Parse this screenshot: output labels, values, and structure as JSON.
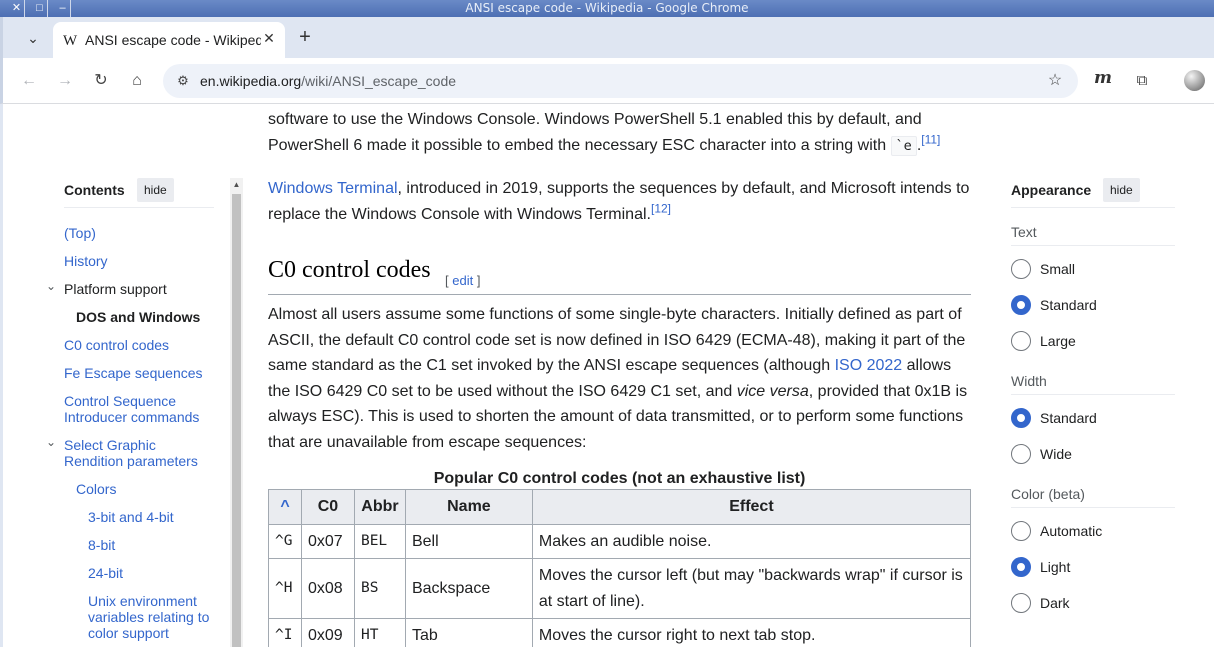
{
  "window": {
    "title": "ANSI escape code - Wikipedia - Google Chrome"
  },
  "tabs": {
    "active": {
      "favicon": "W",
      "title": "ANSI escape code - Wikipedia"
    }
  },
  "toolbar": {
    "url_domain": "en.wikipedia.org",
    "url_path": "/wiki/ANSI_escape_code"
  },
  "article": {
    "intro_line1": "software to use the Windows Console. Windows PowerShell 5.1 enabled this by default, and",
    "intro_line2": "PowerShell 6 made it possible to embed the necessary ESC character into a string with",
    "intro_code": "`e",
    "intro_end": ".",
    "intro_ref": "[11]",
    "terminal_link": "Windows Terminal",
    "terminal_text": ", introduced in 2019, supports the sequences by default, and Microsoft intends to replace the Windows Console with Windows Terminal.",
    "terminal_ref": "[12]",
    "section_heading": "C0 control codes",
    "edit_open": "[ ",
    "edit_label": "edit",
    "edit_close": " ]",
    "c0_text_1": "Almost all users assume some functions of some single-byte characters. Initially defined as part of ASCII, the default C0 control code set is now defined in ISO 6429 (ECMA-48), making it part of the same standard as the C1 set invoked by the ANSI escape sequences (although ",
    "c0_link": "ISO 2022",
    "c0_text_2": " allows the ISO 6429 C0 set to be used without the ISO 6429 C1 set, and ",
    "c0_italic": "vice versa",
    "c0_text_3": ", provided that 0x1B is always ESC). This is used to shorten the amount of data transmitted, or to perform some functions that are unavailable from escape sequences:",
    "table_caption": "Popular C0 control codes (not an exhaustive list)",
    "table_headers": [
      "^",
      "C0",
      "Abbr",
      "Name",
      "Effect"
    ],
    "table_rows": [
      {
        "caret": "^G",
        "c0": "0x07",
        "abbr": "BEL",
        "name": "Bell",
        "effect": "Makes an audible noise."
      },
      {
        "caret": "^H",
        "c0": "0x08",
        "abbr": "BS",
        "name": "Backspace",
        "effect": "Moves the cursor left (but may \"backwards wrap\" if cursor is at start of line)."
      },
      {
        "caret": "^I",
        "c0": "0x09",
        "abbr": "HT",
        "name": "Tab",
        "effect": "Moves the cursor right to next tab stop."
      }
    ]
  },
  "toc": {
    "title": "Contents",
    "hide_label": "hide",
    "items": [
      {
        "label": "(Top)"
      },
      {
        "label": "History"
      },
      {
        "label": "Platform support"
      },
      {
        "label": "DOS and Windows"
      },
      {
        "label": "C0 control codes"
      },
      {
        "label": "Fe Escape sequences"
      },
      {
        "label": "Control Sequence",
        "label2": "Introducer commands"
      },
      {
        "label": "Select Graphic",
        "label2": "Rendition parameters"
      },
      {
        "label": "Colors"
      },
      {
        "label": "3-bit and 4-bit"
      },
      {
        "label": "8-bit"
      },
      {
        "label": "24-bit"
      },
      {
        "label": "Unix environment",
        "label2": "variables relating to",
        "label3": "color support"
      }
    ]
  },
  "appearance": {
    "title": "Appearance",
    "hide_label": "hide",
    "text_group": "Text",
    "text_options": [
      {
        "label": "Small",
        "selected": false
      },
      {
        "label": "Standard",
        "selected": true
      },
      {
        "label": "Large",
        "selected": false
      }
    ],
    "width_group": "Width",
    "width_options": [
      {
        "label": "Standard",
        "selected": true
      },
      {
        "label": "Wide",
        "selected": false
      }
    ],
    "color_group": "Color (beta)",
    "color_options": [
      {
        "label": "Automatic",
        "selected": false
      },
      {
        "label": "Light",
        "selected": true
      },
      {
        "label": "Dark",
        "selected": false
      }
    ]
  },
  "colors": {
    "link": "#3366cc",
    "text": "#202122",
    "titlebar": "#5a7cbd"
  }
}
